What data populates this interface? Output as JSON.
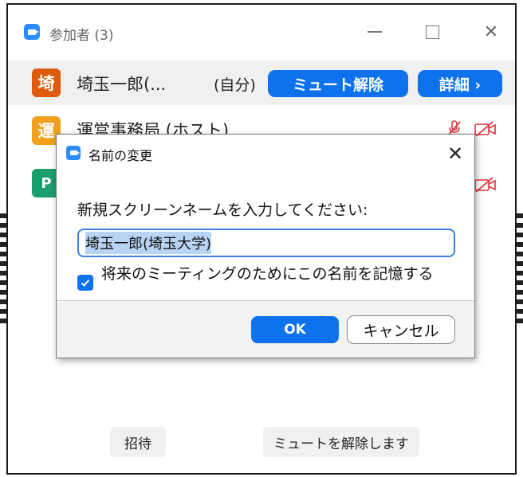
{
  "window": {
    "title": "参加者 (3)"
  },
  "participants": [
    {
      "avatar_char": "埼",
      "name": "埼玉一郎(...",
      "self_tag": "(自分)",
      "unmute_label": "ミュート解除",
      "details_label": "詳細 ›",
      "avatar_color": "#e05a0c"
    },
    {
      "avatar_char": "運",
      "name": "運営事務局 (ホスト)",
      "avatar_color": "#f0a01c"
    },
    {
      "avatar_char": "P",
      "avatar_color": "#1b9e6e"
    }
  ],
  "footer": {
    "invite_label": "招待",
    "unmute_all_label": "ミュートを解除します"
  },
  "dialog": {
    "title": "名前の変更",
    "prompt": "新規スクリーンネームを入力してください:",
    "input_value": "埼玉一郎(埼玉大学)",
    "remember_checked": true,
    "remember_label": "将来のミーティングのためにこの名前を記憶する",
    "ok_label": "OK",
    "cancel_label": "キャンセル"
  },
  "colors": {
    "accent": "#0e72ed",
    "zoom_blue": "#2d8cff",
    "muted_red": "#e0333a"
  }
}
